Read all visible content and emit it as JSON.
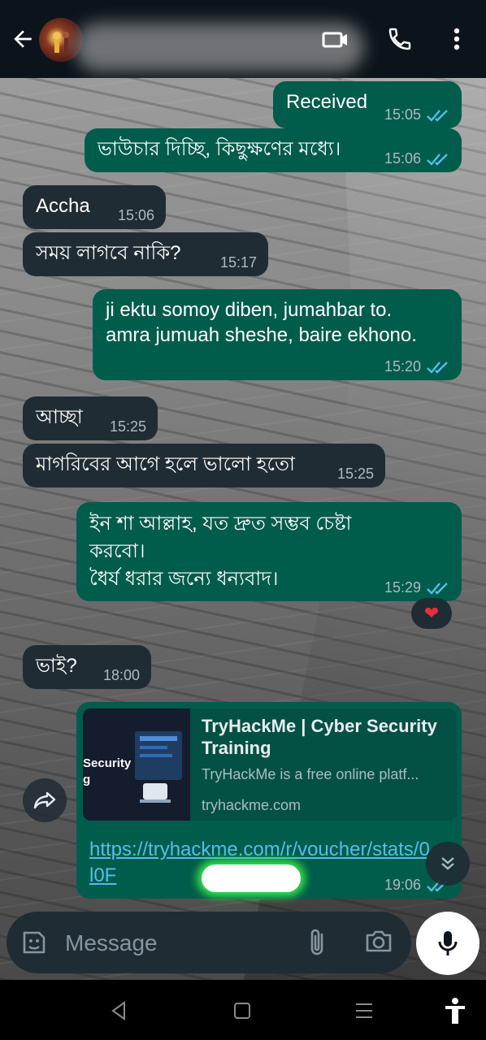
{
  "header": {
    "back_icon": "arrow-left-icon",
    "avatar_icon": "avatar",
    "contact_name_redacted": true,
    "icons": [
      "video-call-icon",
      "phone-icon",
      "more-vertical-icon"
    ]
  },
  "messages": [
    {
      "direction": "out",
      "text": "Received",
      "time": "15:05",
      "ticks": "double-check-read-icon"
    },
    {
      "direction": "out",
      "text": "ভাউচার দিচ্ছি, কিছুক্ষণের মধ্যে।",
      "time": "15:06",
      "ticks": "double-check-read-icon"
    },
    {
      "direction": "in",
      "text": "Accha",
      "time": "15:06"
    },
    {
      "direction": "in",
      "text": "সময় লাগবে নাকি?",
      "time": "15:17"
    },
    {
      "direction": "out",
      "text": "ji ektu somoy diben, jumahbar to.\namra jumuah sheshe, baire ekhono.",
      "time": "15:20",
      "ticks": "double-check-read-icon"
    },
    {
      "direction": "in",
      "text": "আচ্ছা",
      "time": "15:25"
    },
    {
      "direction": "in",
      "text": "মাগরিবের আগে হলে ভালো হতো",
      "time": "15:25"
    },
    {
      "direction": "out",
      "text": "ইন শা আল্লাহ, যত দ্রুত সম্ভব চেষ্টা\nকরবো।\nধৈর্য ধরার জন্যে ধন্যবাদ।",
      "time": "15:29",
      "ticks": "double-check-read-icon",
      "reaction": "❤"
    },
    {
      "direction": "in",
      "text": "ভাই?",
      "time": "18:00"
    }
  ],
  "link_message": {
    "preview_title": "TryHackMe | Cyber Security Training",
    "preview_description": "TryHackMe is a free online platf...",
    "preview_domain": "tryhackme.com",
    "thumb_text_1": "Security",
    "thumb_text_2": "g",
    "url_text": "https://tryhackme.com/r/voucher/stats/0l0F",
    "time": "19:06",
    "ticks": "double-check-read-icon"
  },
  "composer": {
    "placeholder": "Message",
    "icons": [
      "emoji-icon",
      "paperclip-icon",
      "camera-icon",
      "mic-icon"
    ]
  },
  "floating": {
    "forward_icon": "forward-icon",
    "scroll_icon": "double-chevron-down-icon"
  },
  "colors": {
    "header_bg": "#0b141a",
    "outgoing_bubble": "#005c4b",
    "incoming_bubble": "#202c33",
    "link": "#53bdeb",
    "read_ticks": "#53bdeb"
  },
  "navbar": {
    "icons": [
      "nav-back-icon",
      "nav-home-icon",
      "nav-recent-icon",
      "accessibility-icon"
    ]
  }
}
